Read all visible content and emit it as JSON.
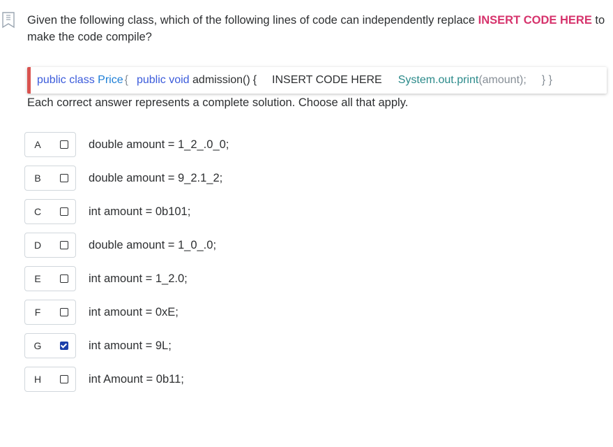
{
  "question": {
    "text_before": "Given the following class, which of the following lines of code can independently replace ",
    "highlight": "INSERT CODE HERE",
    "text_after": " to make the code compile?",
    "highlight_color": "#d6336c"
  },
  "code": {
    "public_class": "public class",
    "class_name": "Price",
    "brace_open": "{",
    "method_sig_kw": "public void",
    "method_name": "admission()",
    "method_brace": "{",
    "insert": "INSERT CODE HERE",
    "system_out": "System.out.print",
    "arg": "(amount);",
    "closing": "} }",
    "accent_color": "#d9534f"
  },
  "instruction": "Each correct answer represents a complete solution. Choose all that apply.",
  "options": [
    {
      "letter": "A",
      "text": "double amount = 1_2_.0_0;",
      "checked": false
    },
    {
      "letter": "B",
      "text": "double amount = 9_2.1_2;",
      "checked": false
    },
    {
      "letter": "C",
      "text": "int amount = 0b101;",
      "checked": false
    },
    {
      "letter": "D",
      "text": "double amount = 1_0_.0;",
      "checked": false
    },
    {
      "letter": "E",
      "text": "int amount = 1_2.0;",
      "checked": false
    },
    {
      "letter": "F",
      "text": "int amount = 0xE;",
      "checked": false
    },
    {
      "letter": "G",
      "text": "int amount = 9L;",
      "checked": true
    },
    {
      "letter": "H",
      "text": "int Amount = 0b11;",
      "checked": false
    }
  ],
  "icons": {
    "bookmark": "bookmark-icon"
  }
}
